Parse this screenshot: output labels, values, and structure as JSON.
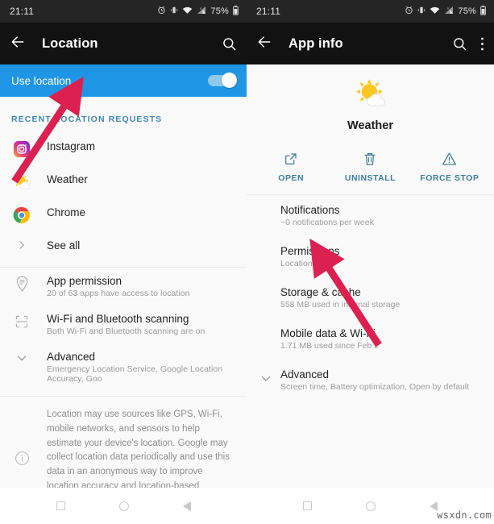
{
  "colors": {
    "accent_blue": "#1f96e5",
    "status_bar": "#252525",
    "app_bar": "#121212",
    "arrow": "#dc2150",
    "action_label": "#3c7f9e",
    "section_head": "#3d86b8"
  },
  "watermark": "wsxdn.com",
  "left_phone": {
    "status_bar": {
      "clock": "21:11",
      "battery_percent": "75%",
      "icons": [
        "alarm-icon",
        "vibrate-icon",
        "wifi-icon",
        "cellular-signal-icon",
        "battery-icon"
      ]
    },
    "app_bar": {
      "back_label": "back-arrow-icon",
      "title": "Location",
      "actions": [
        "search-icon"
      ]
    },
    "use_location": {
      "label": "Use location",
      "toggle_state": "on"
    },
    "section_header": "RECENT LOCATION REQUESTS",
    "recent_requests": [
      {
        "icon": "instagram-icon",
        "name": "Instagram"
      },
      {
        "icon": "weather-icon",
        "name": "Weather"
      },
      {
        "icon": "chrome-icon",
        "name": "Chrome"
      }
    ],
    "see_all": "See all",
    "settings_rows": [
      {
        "icon": "location-permission-icon",
        "title": "App permission",
        "subtitle": "20 of 63 apps have access to location"
      },
      {
        "icon": "scanning-icon",
        "title": "Wi-Fi and Bluetooth scanning",
        "subtitle": "Both Wi-Fi and Bluetooth scanning are on"
      },
      {
        "icon": "chevron-down-icon",
        "title": "Advanced",
        "subtitle": "Emergency Location Service, Google Location Accuracy, Goo"
      }
    ],
    "footer_note": "Location may use sources like GPS, Wi-Fi, mobile networks, and sensors to help estimate your device's location. Google may collect location data periodically and use this data in an anonymous way to improve location accuracy and location-based services.",
    "nav_bar": [
      "recents-square-icon",
      "home-circle-icon",
      "back-triangle-icon"
    ]
  },
  "right_phone": {
    "status_bar": {
      "clock": "21:11",
      "battery_percent": "75%",
      "icons": [
        "alarm-icon",
        "vibrate-icon",
        "wifi-icon",
        "cellular-signal-icon",
        "battery-icon"
      ]
    },
    "app_bar": {
      "back_label": "back-arrow-icon",
      "title": "App info",
      "actions": [
        "search-icon",
        "overflow-menu-icon"
      ]
    },
    "app": {
      "icon": "weather-icon",
      "name": "Weather"
    },
    "quick_actions": [
      {
        "icon": "open-external-icon",
        "label": "OPEN"
      },
      {
        "icon": "trash-icon",
        "label": "UNINSTALL"
      },
      {
        "icon": "warning-triangle-icon",
        "label": "FORCE STOP"
      }
    ],
    "detail_rows": [
      {
        "title": "Notifications",
        "subtitle": "~0 notifications per week"
      },
      {
        "title": "Permissions",
        "subtitle": "Location"
      },
      {
        "title": "Storage & cache",
        "subtitle": "558 MB used in internal storage"
      },
      {
        "title": "Mobile data & Wi-Fi",
        "subtitle": "1.71 MB used since Feb 2"
      },
      {
        "title": "Advanced",
        "subtitle": "Screen time, Battery optimization, Open by default",
        "icon": "chevron-down-icon"
      }
    ],
    "nav_bar": [
      "recents-square-icon",
      "home-circle-icon",
      "back-triangle-icon"
    ]
  },
  "annotations": [
    {
      "name": "arrow-to-use-location-toggle",
      "target": "Use location toggle"
    },
    {
      "name": "arrow-to-permissions-row",
      "target": "Permissions row"
    }
  ]
}
